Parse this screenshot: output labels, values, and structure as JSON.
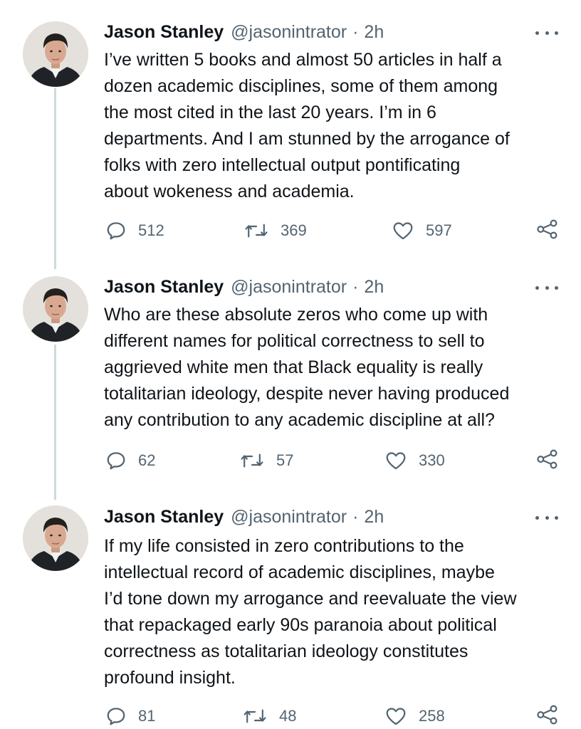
{
  "tweets": [
    {
      "author_name": "Jason Stanley",
      "handle": "@jasonintrator",
      "separator": "·",
      "time": "2h",
      "text": "I’ve written 5 books and almost 50 articles in half a\ndozen academic disciplines, some of them among\nthe most cited in the last 20 years. I’m in 6\ndepartments. And I am stunned by the arrogance of\nfolks with zero intellectual output pontificating\nabout wokeness and academia.",
      "replies": "512",
      "retweets": "369",
      "likes": "597"
    },
    {
      "author_name": "Jason Stanley",
      "handle": "@jasonintrator",
      "separator": "·",
      "time": "2h",
      "text": "Who are these absolute zeros who come up with\ndifferent names for political correctness to sell to\naggrieved white men that Black equality is really\ntotalitarian ideology, despite never having produced\nany contribution to any academic discipline at all?",
      "replies": "62",
      "retweets": "57",
      "likes": "330"
    },
    {
      "author_name": "Jason Stanley",
      "handle": "@jasonintrator",
      "separator": "·",
      "time": "2h",
      "text": "If my life consisted in zero contributions to the\nintellectual record of academic disciplines, maybe\nI’d tone down my arrogance and reevaluate the view\nthat repackaged early 90s paranoia about political\ncorrectness as totalitarian ideology constitutes\nprofound insight.",
      "replies": "81",
      "retweets": "48",
      "likes": "258"
    }
  ],
  "icons": {
    "reply": "reply-icon",
    "retweet": "retweet-icon",
    "like": "heart-icon",
    "share": "share-icon",
    "more": "more-icon"
  },
  "colors": {
    "text": "#0f1419",
    "secondary": "#536471",
    "thread_line": "#cfd9de"
  }
}
